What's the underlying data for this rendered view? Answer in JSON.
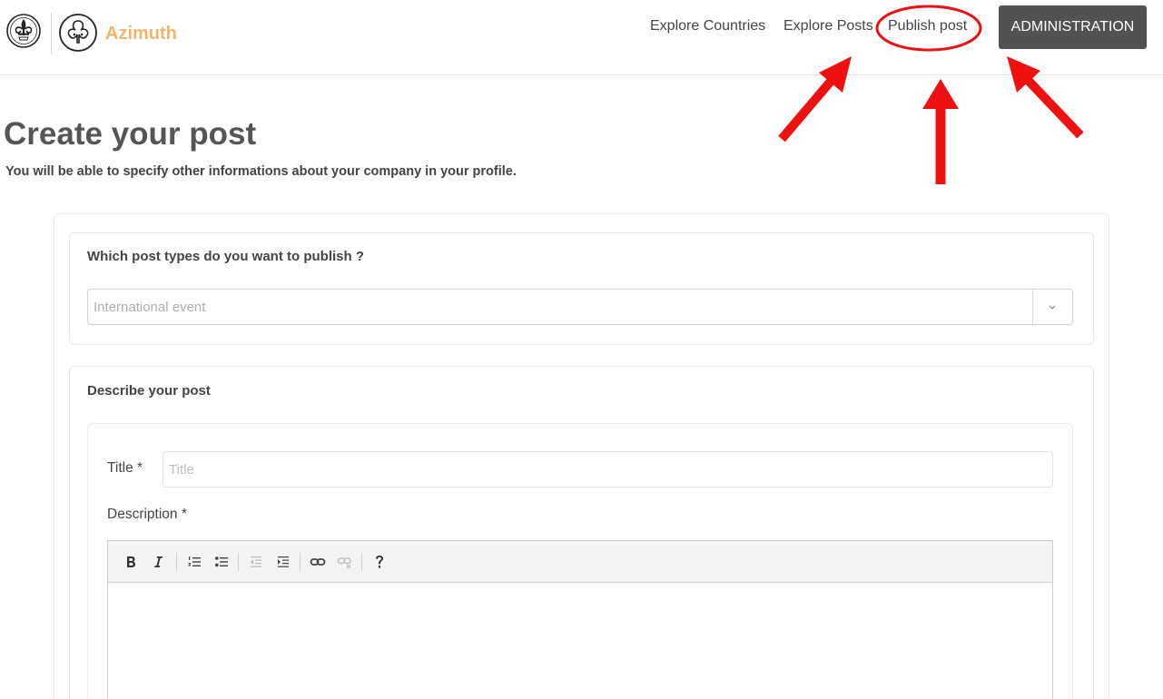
{
  "header": {
    "brand": "Azimuth",
    "nav": {
      "countries": "Explore Countries",
      "posts": "Explore Posts",
      "publish": "Publish post"
    },
    "admin_button": "ADMINISTRATION"
  },
  "page": {
    "title": "Create your post",
    "subtitle": "You will be able to specify other informations about your company in your profile."
  },
  "post_types": {
    "label": "Which post types do you want to publish ?",
    "selected": "International event"
  },
  "describe": {
    "label": "Describe your post",
    "title_label": "Title *",
    "title_placeholder": "Title",
    "title_value": "",
    "description_label": "Description *"
  },
  "editor_toolbar": [
    "bold-icon",
    "italic-icon",
    "ordered-list-icon",
    "unordered-list-icon",
    "outdent-icon",
    "indent-icon",
    "link-icon",
    "unlink-icon",
    "help-icon"
  ],
  "colors": {
    "brand": "#f2b36b",
    "admin_button": "#525252",
    "annotation": "#ee1111"
  }
}
